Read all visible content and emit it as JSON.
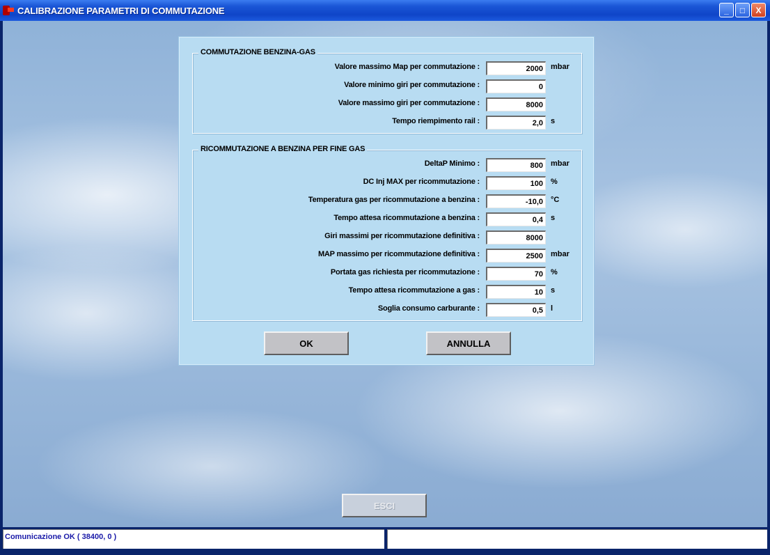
{
  "window": {
    "title": "CALIBRAZIONE PARAMETRI DI COMMUTAZIONE",
    "controls": {
      "minimize": "_",
      "maximize": "□",
      "close": "X"
    }
  },
  "group1": {
    "title": "COMMUTAZIONE BENZINA-GAS",
    "rows": [
      {
        "label": "Valore massimo Map per commutazione :",
        "value": "2000",
        "unit": "mbar"
      },
      {
        "label": "Valore minimo giri per commutazione :",
        "value": "0",
        "unit": ""
      },
      {
        "label": "Valore massimo giri per commutazione :",
        "value": "8000",
        "unit": ""
      },
      {
        "label": "Tempo riempimento rail :",
        "value": "2,0",
        "unit": "s"
      }
    ]
  },
  "group2": {
    "title": "RICOMMUTAZIONE A BENZINA PER FINE GAS",
    "rows": [
      {
        "label": "DeltaP Minimo :",
        "value": "800",
        "unit": "mbar"
      },
      {
        "label": "DC Inj MAX per ricommutazione :",
        "value": "100",
        "unit": "%"
      },
      {
        "label": "Temperatura gas per ricommutazione a benzina :",
        "value": "-10,0",
        "unit": "°C"
      },
      {
        "label": "Tempo attesa ricommutazione a benzina :",
        "value": "0,4",
        "unit": "s"
      },
      {
        "label": "Giri massimi per ricommutazione definitiva :",
        "value": "8000",
        "unit": ""
      },
      {
        "label": "MAP massimo per ricommutazione definitiva :",
        "value": "2500",
        "unit": "mbar"
      },
      {
        "label": "Portata gas richiesta per ricommutazione :",
        "value": "70",
        "unit": "%"
      },
      {
        "label": "Tempo attesa ricommutazione a gas :",
        "value": "10",
        "unit": "s"
      },
      {
        "label": "Soglia consumo carburante :",
        "value": "0,5",
        "unit": "l"
      }
    ]
  },
  "buttons": {
    "ok": "OK",
    "cancel": "ANNULLA",
    "exit": "ESCI"
  },
  "status": {
    "left": "Comunicazione OK ( 38400,  0 )",
    "right": ""
  }
}
